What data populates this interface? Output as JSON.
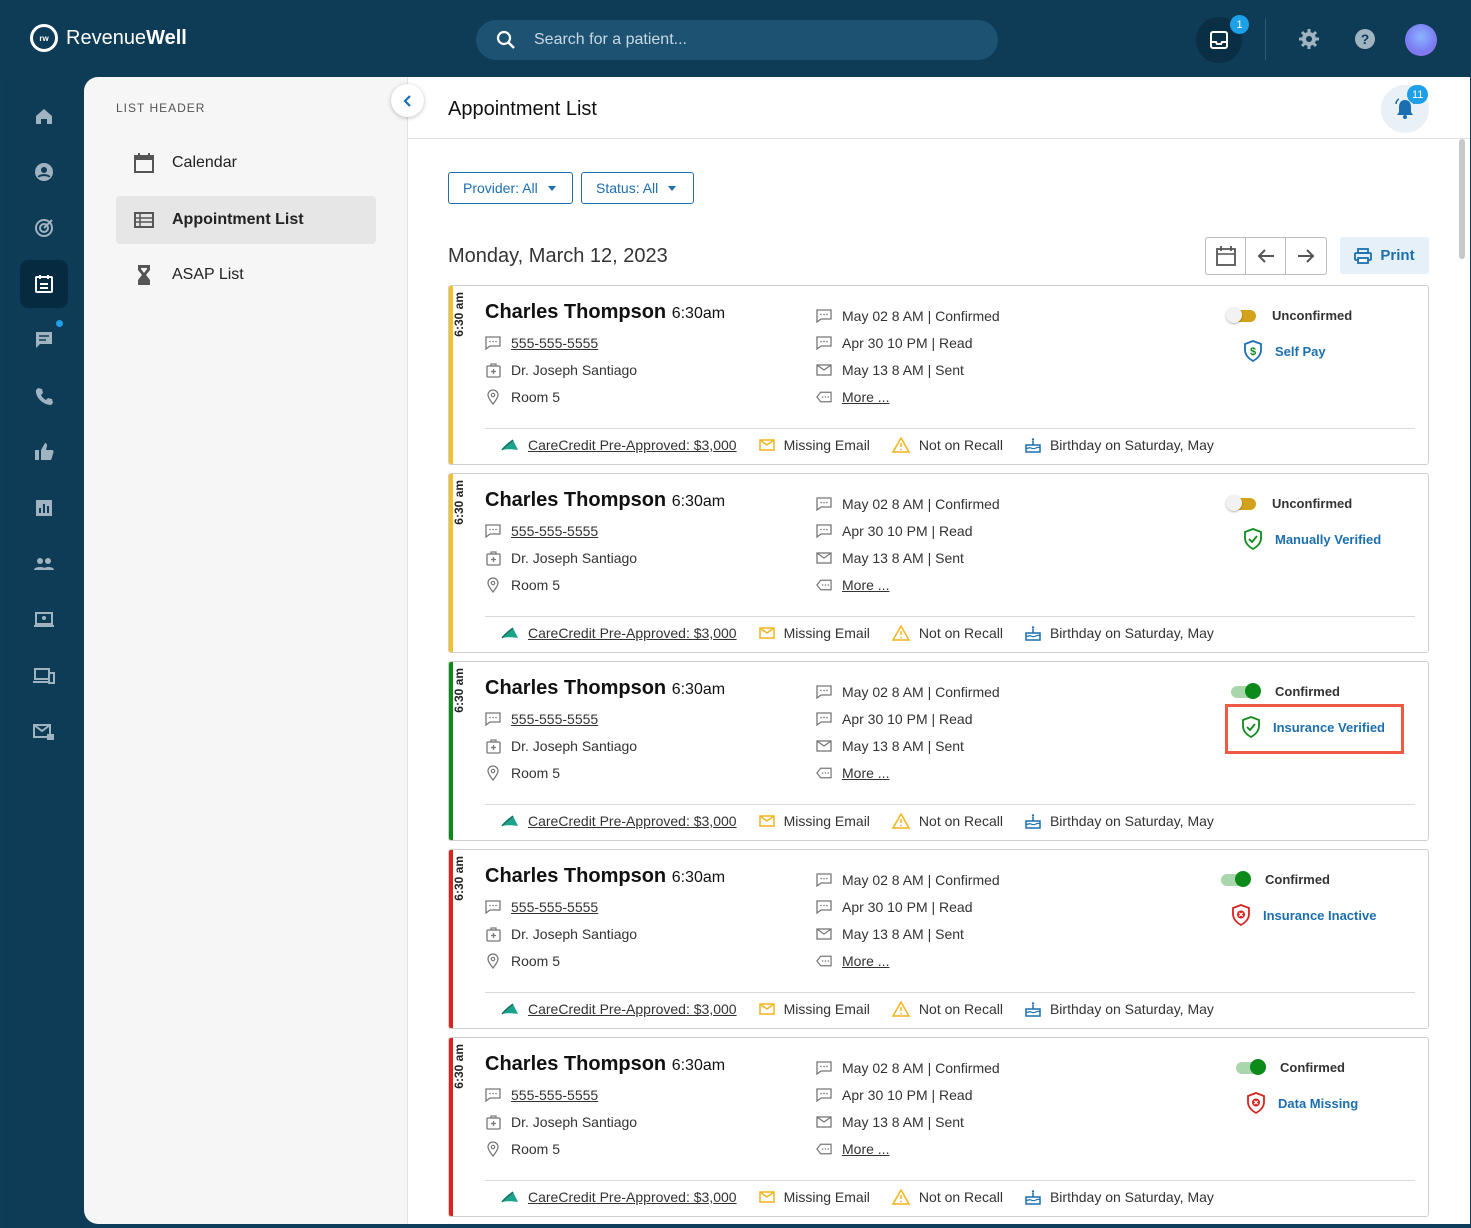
{
  "app": {
    "logo_text_light": "Revenue",
    "logo_text_bold": "Well",
    "logo_mark": "rw",
    "search_placeholder": "Search for a patient...",
    "inbox_badge": "1",
    "notification_badge": "11"
  },
  "rail": {
    "items": [
      "home-icon",
      "account-icon",
      "target-icon",
      "calendar-list-icon",
      "chat-icon",
      "phone-icon",
      "thumbs-up-icon",
      "report-icon",
      "group-icon",
      "laptop-icon",
      "devices-icon",
      "mail-lock-icon"
    ],
    "active_index": 3
  },
  "panel": {
    "header": "LIST HEADER",
    "items": [
      {
        "label": "Calendar",
        "icon": "calendar-icon"
      },
      {
        "label": "Appointment List",
        "icon": "list-icon"
      },
      {
        "label": "ASAP List",
        "icon": "hourglass-icon"
      }
    ],
    "active_index": 1
  },
  "main": {
    "title": "Appointment List",
    "filters": {
      "provider": "Provider: All",
      "status": "Status: All"
    },
    "date": "Monday, March 12, 2023",
    "print_label": "Print"
  },
  "colors": {
    "yellow": "#f3c12b",
    "green": "#0c8b1a",
    "red": "#d9231f",
    "link": "#1b6fb0",
    "highlight": "#ef5a44"
  },
  "appointments": [
    {
      "time_vertical": "6:30 am",
      "name": "Charles Thompson",
      "time": "6:30am",
      "phone": "555-555-5555",
      "doctor": "Dr. Joseph Santiago",
      "room": "Room 5",
      "events": [
        "May 02 8 AM | Confirmed",
        "Apr 30 10 PM | Read",
        "May 13 8 AM | Sent"
      ],
      "more": "More ...",
      "status": "Unconfirmed",
      "insurance": "Self Pay",
      "tags": {
        "carecredit": "CareCredit Pre-Approved: $3,000",
        "email": "Missing Email",
        "recall": "Not on Recall",
        "birthday": "Birthday on Saturday, May"
      }
    },
    {
      "time_vertical": "6:30 am",
      "name": "Charles Thompson",
      "time": "6:30am",
      "phone": "555-555-5555",
      "doctor": "Dr. Joseph Santiago",
      "room": "Room 5",
      "events": [
        "May 02 8 AM | Confirmed",
        "Apr 30 10 PM | Read",
        "May 13 8 AM | Sent"
      ],
      "more": "More ...",
      "status": "Unconfirmed",
      "insurance": "Manually Verified",
      "tags": {
        "carecredit": "CareCredit Pre-Approved: $3,000",
        "email": "Missing Email",
        "recall": "Not on Recall",
        "birthday": "Birthday on Saturday, May"
      }
    },
    {
      "time_vertical": "6:30 am",
      "name": "Charles Thompson",
      "time": "6:30am",
      "phone": "555-555-5555",
      "doctor": "Dr. Joseph Santiago",
      "room": "Room 5",
      "events": [
        "May 02 8 AM | Confirmed",
        "Apr 30 10 PM | Read",
        "May 13 8 AM | Sent"
      ],
      "more": "More ...",
      "status": "Confirmed",
      "insurance": "Insurance Verified",
      "tags": {
        "carecredit": "CareCredit Pre-Approved: $3,000",
        "email": "Missing Email",
        "recall": "Not on Recall",
        "birthday": "Birthday on Saturday, May"
      }
    },
    {
      "time_vertical": "6:30 am",
      "name": "Charles Thompson",
      "time": "6:30am",
      "phone": "555-555-5555",
      "doctor": "Dr. Joseph Santiago",
      "room": "Room 5",
      "events": [
        "May 02 8 AM | Confirmed",
        "Apr 30 10 PM | Read",
        "May 13 8 AM | Sent"
      ],
      "more": "More ...",
      "status": "Confirmed",
      "insurance": "Insurance Inactive",
      "tags": {
        "carecredit": "CareCredit Pre-Approved: $3,000",
        "email": "Missing Email",
        "recall": "Not on Recall",
        "birthday": "Birthday on Saturday, May"
      }
    },
    {
      "time_vertical": "6:30 am",
      "name": "Charles Thompson",
      "time": "6:30am",
      "phone": "555-555-5555",
      "doctor": "Dr. Joseph Santiago",
      "room": "Room 5",
      "events": [
        "May 02 8 AM | Confirmed",
        "Apr 30 10 PM | Read",
        "May 13 8 AM | Sent"
      ],
      "more": "More ...",
      "status": "Confirmed",
      "insurance": "Data Missing",
      "tags": {
        "carecredit": "CareCredit Pre-Approved: $3,000",
        "email": "Missing Email",
        "recall": "Not on Recall",
        "birthday": "Birthday on Saturday, May"
      }
    }
  ]
}
